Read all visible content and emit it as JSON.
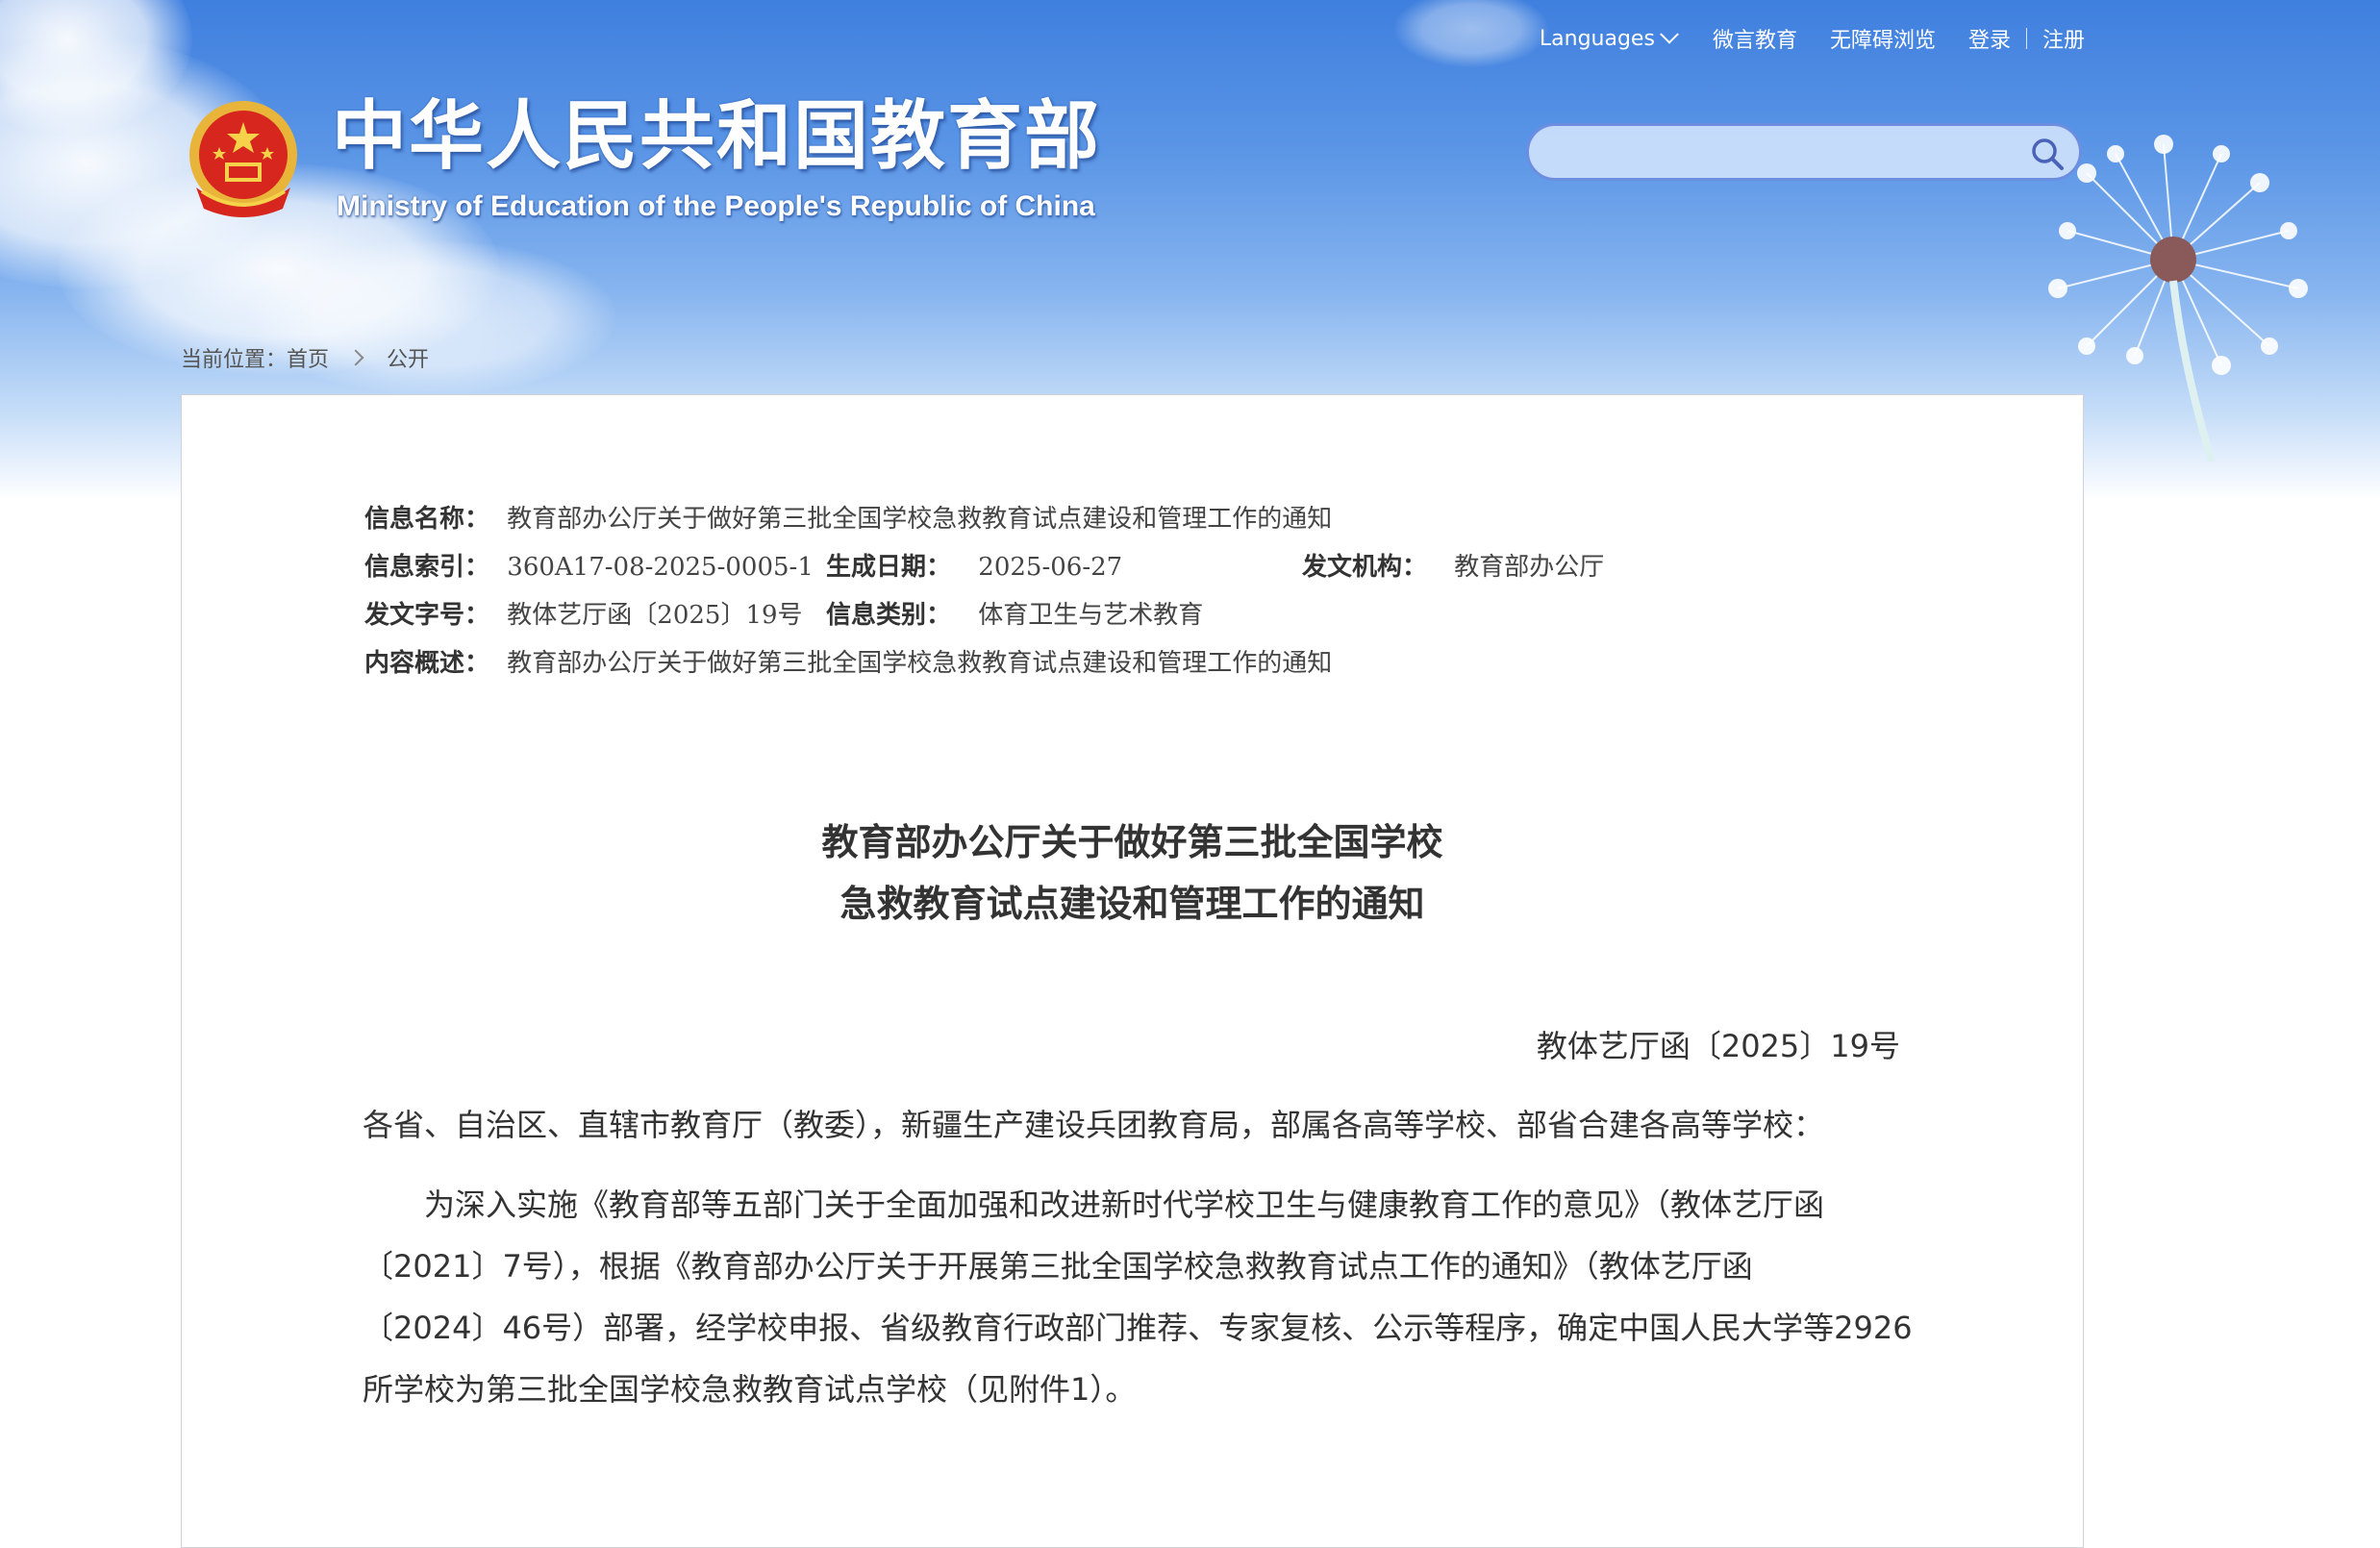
{
  "header": {
    "title_cn": "中华人民共和国教育部",
    "title_en": "Ministry of Education of the People's Republic of China",
    "top_links": {
      "languages": "Languages",
      "weiyan": "微言教育",
      "accessibility": "无障碍浏览",
      "login": "登录",
      "register": "注册"
    },
    "search": {
      "placeholder": ""
    }
  },
  "breadcrumb": {
    "prefix": "当前位置：",
    "home": "首页",
    "current": "公开"
  },
  "meta": {
    "name_label": "信息名称：",
    "name_value": "教育部办公厅关于做好第三批全国学校急救教育试点建设和管理工作的通知",
    "index_label": "信息索引：",
    "index_value": "360A17-08-2025-0005-1",
    "date_label": "生成日期：",
    "date_value": "2025-06-27",
    "org_label": "发文机构：",
    "org_value": "教育部办公厅",
    "docno_label": "发文字号：",
    "docno_value": "教体艺厅函〔2025〕19号",
    "category_label": "信息类别：",
    "category_value": "体育卫生与艺术教育",
    "summary_label": "内容概述：",
    "summary_value": "教育部办公厅关于做好第三批全国学校急救教育试点建设和管理工作的通知"
  },
  "document": {
    "title_line1": "教育部办公厅关于做好第三批全国学校",
    "title_line2": "急救教育试点建设和管理工作的通知",
    "doc_number": "教体艺厅函〔2025〕19号",
    "addressee": "各省、自治区、直辖市教育厅（教委），新疆生产建设兵团教育局，部属各高等学校、部省合建各高等学校：",
    "para1_lines": [
      "　　为深入实施《教育部等五部门关于全面加强和改进新时代学校卫生与健康教育工作的意见》（教体艺厅函",
      "〔2021〕7号），根据《教育部办公厅关于开展第三批全国学校急救教育试点工作的通知》（教体艺厅函",
      "〔2024〕46号）部署，经学校申报、省级教育行政部门推荐、专家复核、公示等程序，确定中国人民大学等2926",
      "所学校为第三批全国学校急救教育试点学校（见附件1）。"
    ]
  },
  "colors": {
    "sky_top": "#3f7fde",
    "search_border": "#6d8ee0",
    "text_main": "#333333"
  }
}
